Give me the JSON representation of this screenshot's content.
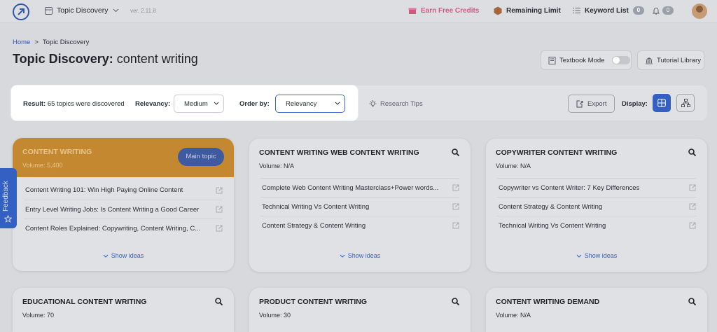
{
  "topbar": {
    "tool_name": "Topic Discovery",
    "version": "ver. 2.11.8",
    "earn_credits": "Earn Free Credits",
    "remaining_limit": "Remaining Limit",
    "keyword_list": "Keyword List",
    "keyword_count": "0",
    "notifications_count": "0"
  },
  "breadcrumb": {
    "home": "Home",
    "separator": ">",
    "current": "Topic Discovery"
  },
  "page": {
    "title_prefix": "Topic Discovery:",
    "title_keyword": "content writing"
  },
  "actions": {
    "textbook_mode": "Textbook Mode",
    "tutorial_library": "Tutorial Library"
  },
  "filters": {
    "result_label": "Result:",
    "result_text": "65 topics were discovered",
    "relevancy_label": "Relevancy:",
    "relevancy_value": "Medium",
    "order_label": "Order by:",
    "order_value": "Relevancy",
    "research_tips": "Research Tips",
    "export": "Export",
    "display_label": "Display:"
  },
  "cards": [
    {
      "title": "CONTENT WRITING",
      "volume": "Volume: 5,400",
      "badge": "Main topic",
      "ideas": [
        "Content Writing 101: Win High Paying Online Content",
        "Entry Level Writing Jobs: Is Content Writing a Good Career",
        "Content Roles Explained: Copywriting, Content Writing, C..."
      ],
      "show_ideas": "Show ideas"
    },
    {
      "title": "CONTENT WRITING WEB CONTENT WRITING",
      "volume": "Volume: N/A",
      "ideas": [
        "Complete Web Content Writing Masterclass+Power words...",
        "Technical Writing Vs Content Writing",
        "Content Strategy & Content Writing"
      ],
      "show_ideas": "Show ideas"
    },
    {
      "title": "COPYWRITER CONTENT WRITING",
      "volume": "Volume: N/A",
      "ideas": [
        "Copywriter vs Content Writer: 7 Key Differences",
        "Content Strategy & Content Writing",
        "Technical Writing Vs Content Writing"
      ],
      "show_ideas": "Show ideas"
    },
    {
      "title": "EDUCATIONAL CONTENT WRITING",
      "volume": "Volume: 70"
    },
    {
      "title": "PRODUCT CONTENT WRITING",
      "volume": "Volume: 30"
    },
    {
      "title": "CONTENT WRITING DEMAND",
      "volume": "Volume: N/A"
    }
  ],
  "feedback": "Feedback",
  "colors": {
    "accent": "#3460c4",
    "main_topic_header": "#c48930",
    "earn_credits": "#d4577f"
  }
}
